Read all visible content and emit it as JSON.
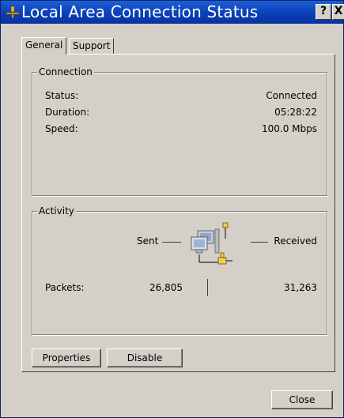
{
  "window": {
    "title": "Local Area Connection Status",
    "help_label": "?",
    "close_glyph": "X",
    "title_icon": "network-connection-icon"
  },
  "tabs": [
    {
      "label": "General",
      "active": true
    },
    {
      "label": "Support",
      "active": false
    }
  ],
  "connection": {
    "legend": "Connection",
    "status_label": "Status:",
    "status_value": "Connected",
    "duration_label": "Duration:",
    "duration_value": "05:28:22",
    "speed_label": "Speed:",
    "speed_value": "100.0 Mbps"
  },
  "activity": {
    "legend": "Activity",
    "sent_label": "Sent",
    "received_label": "Received",
    "packets_label": "Packets:",
    "packets_sent": "26,805",
    "packets_received": "31,263",
    "icon": "network-computers-icon"
  },
  "buttons": {
    "properties": "Properties",
    "disable": "Disable",
    "close": "Close"
  },
  "colors": {
    "titlebar": "#0a3fb8",
    "face": "#d4d0c8"
  }
}
